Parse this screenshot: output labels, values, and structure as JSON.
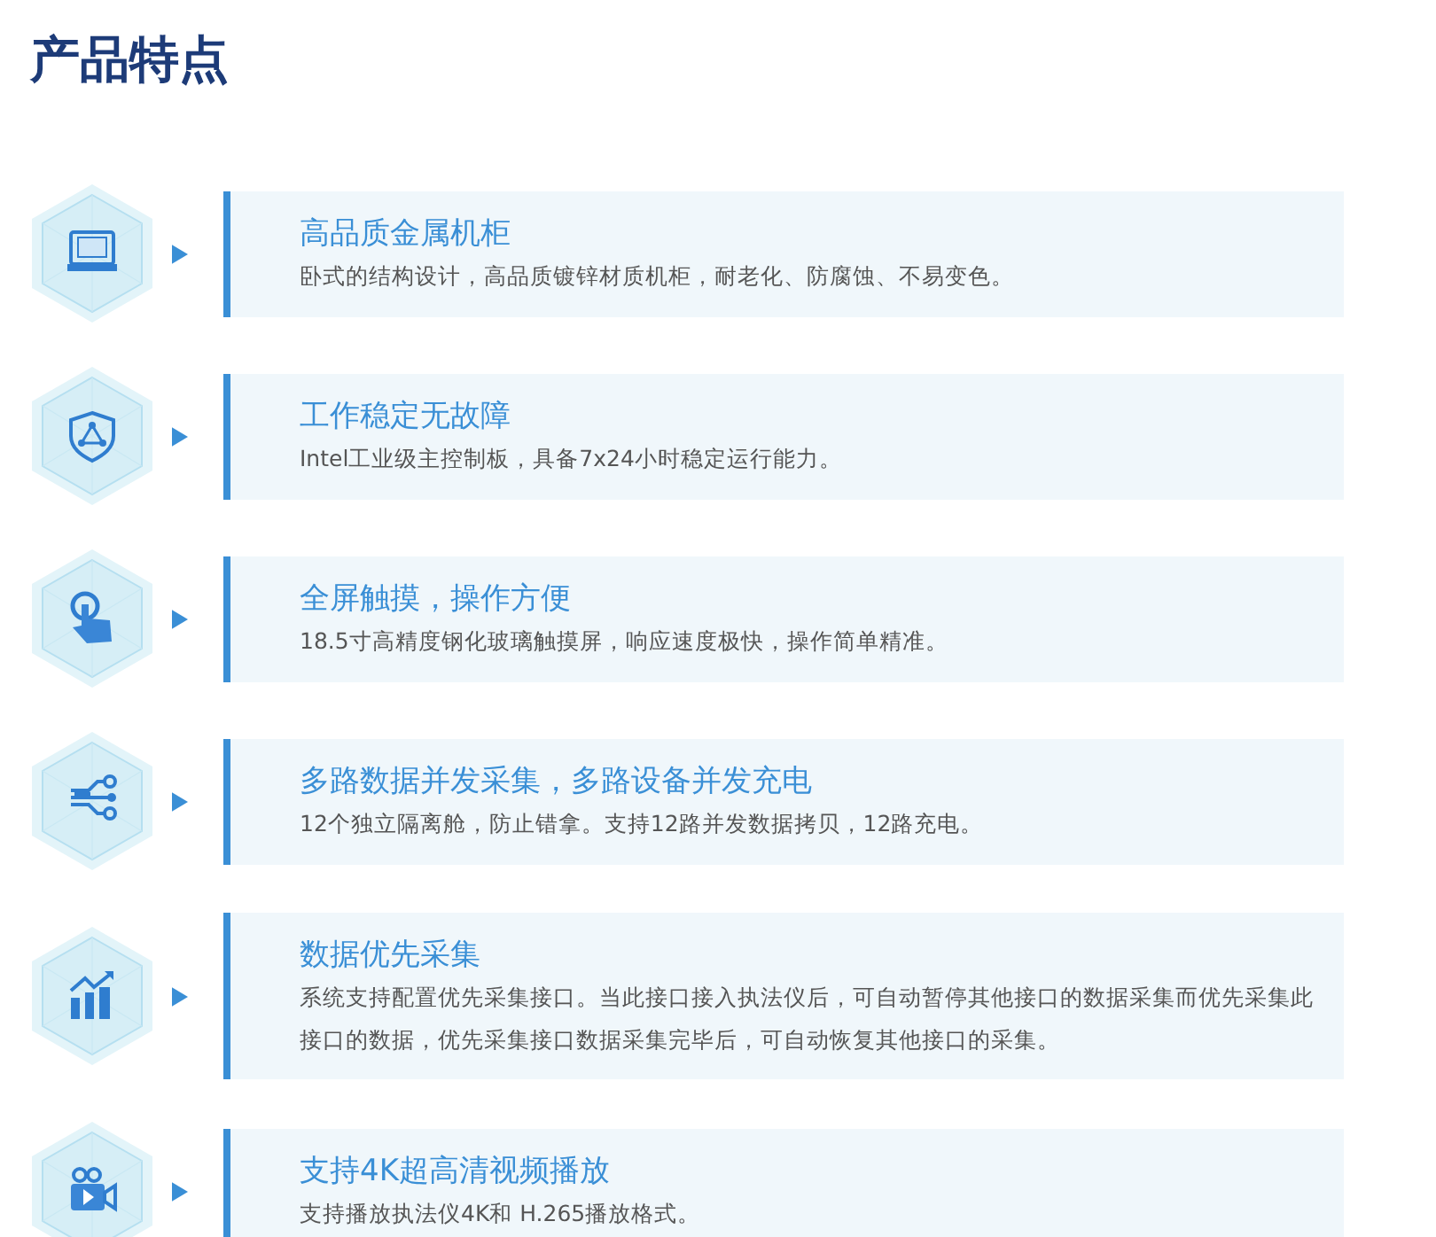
{
  "heading": "产品特点",
  "features": [
    {
      "title": "高品质金属机柜",
      "description": "卧式的结构设计，高品质镀锌材质机柜，耐老化、防腐蚀、不易变色。"
    },
    {
      "title": "工作稳定无故障",
      "description": "Intel工业级主控制板，具备7x24小时稳定运行能力。"
    },
    {
      "title": "全屏触摸，操作方便",
      "description": "18.5寸高精度钢化玻璃触摸屏，响应速度极快，操作简单精准。"
    },
    {
      "title": "多路数据并发采集，多路设备并发充电",
      "description": "12个独立隔离舱，防止错拿。支持12路并发数据拷贝，12路充电。"
    },
    {
      "title": "数据优先采集",
      "description": "系统支持配置优先采集接口。当此接口接入执法仪后，可自动暂停其他接口的数据采集而优先采集此接口的数据，优先采集接口数据采集完毕后，可自动恢复其他接口的采集。"
    },
    {
      "title": "支持4K超高清视频播放",
      "description": "支持播放执法仪4K和 H.265播放格式。"
    }
  ]
}
